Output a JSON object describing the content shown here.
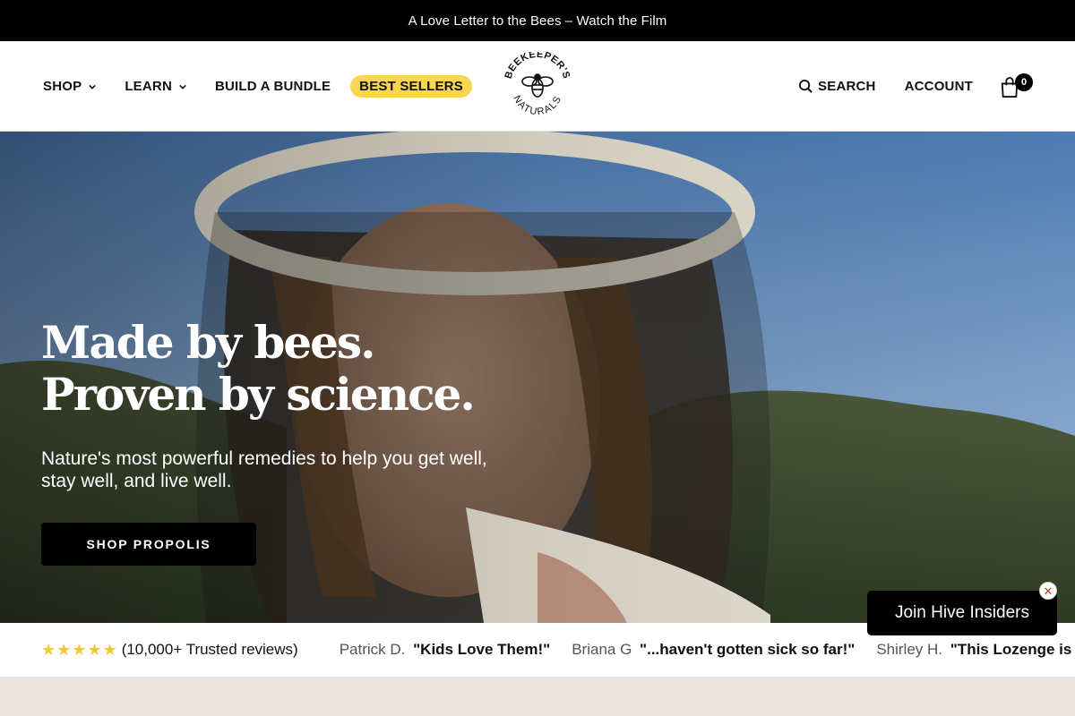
{
  "announcement": {
    "text": "A Love Letter to the Bees – Watch the Film"
  },
  "nav": {
    "shop": "SHOP",
    "learn": "LEARN",
    "build_bundle": "BUILD A BUNDLE",
    "best_sellers": "BEST SELLERS",
    "search": "SEARCH",
    "account": "ACCOUNT",
    "cart_count": "0"
  },
  "logo": {
    "top_text": "BEEKEEPER'S",
    "bottom_text": "NATURALS"
  },
  "hero": {
    "title": "Made by bees. Proven by science.",
    "subtitle": "Nature's most powerful remedies to help you get well, stay well, and live well.",
    "cta": "SHOP PROPOLIS"
  },
  "reviews": {
    "stars": "★★★★★",
    "count_text": "(10,000+ Trusted reviews)",
    "items": [
      {
        "name": "Patrick D.",
        "quote": "\"Kids Love Them!\""
      },
      {
        "name": "Briana G",
        "quote": "\"...haven't gotten sick so far!\""
      },
      {
        "name": "Shirley H.",
        "quote": "\"This Lozenge is the Rea"
      }
    ]
  },
  "popup": {
    "label": "Join Hive Insiders",
    "close": "✕"
  },
  "colors": {
    "announcement_bg": "#000000",
    "best_sellers_bg": "#f8d651",
    "star": "#f0c93a",
    "bottom_band": "#ede5e0"
  }
}
